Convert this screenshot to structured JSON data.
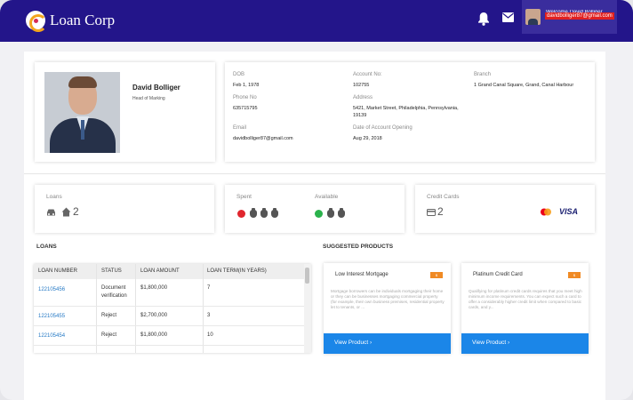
{
  "header": {
    "brand": "Loan Corp",
    "welcome": "Welcome David Bolliger",
    "user_email": "davidbolliger87@gmail.com"
  },
  "profile": {
    "name": "David Bolliger",
    "role": "Head of Marking"
  },
  "details": {
    "dob_label": "DOB",
    "dob": "Feb 1, 1978",
    "account_label": "Account No:",
    "account": "102755",
    "branch_label": "Branch",
    "branch": "1 Grand Canal Square, Grand, Canal Harbour",
    "phone_label": "Phone No",
    "phone": "635715795",
    "address_label": "Address",
    "address_line1": "5421, Market Street, Philadelphia, Pennsylvania,",
    "address_line2": "19139",
    "email_label": "Email",
    "email": "davidbolliger87@gmail.com",
    "opening_label": "Date of Account Opening",
    "opening": "Aug 29, 2018"
  },
  "stats": {
    "loans_label": "Loans",
    "loans_count": "2",
    "spent_label": "Spent",
    "available_label": "Available",
    "cards_label": "Credit Cards",
    "cards_count": "2",
    "card_brand_visa": "VISA"
  },
  "loans": {
    "title": "LOANS",
    "columns": [
      "LOAN NUMBER",
      "STATUS",
      "LOAN AMOUNT",
      "LOAN TERM(IN YEARS)"
    ],
    "rows": [
      {
        "number": "122105456",
        "status_line1": "Document",
        "status_line2": "verification",
        "amount": "$1,800,000",
        "term": "7"
      },
      {
        "number": "122105455",
        "status_line1": "Reject",
        "status_line2": "",
        "amount": "$2,700,000",
        "term": "3"
      },
      {
        "number": "122105454",
        "status_line1": "Reject",
        "status_line2": "",
        "amount": "$1,800,000",
        "term": "10"
      }
    ]
  },
  "products": {
    "title": "SUGGESTED PRODUCTS",
    "items": [
      {
        "name": "Low Interest Mortgage",
        "desc": "Mortgage borrowers can be individuals mortgaging their home or they can be businesses mortgaging commercial property (for example, their own business premises, residential property let to tenants, or ...",
        "button": "View Product  ›"
      },
      {
        "name": "Platinum Credit Card",
        "desc": "Qualifying for platinum credit cards requires that you meet high minimum income requirements. You can expect such a card to offer a considerably higher credit limit when compared to basic cards, and y...",
        "button": "View Product  ›"
      }
    ]
  },
  "colors": {
    "header_bg": "#23158a",
    "button_blue": "#1b86e8",
    "link_blue": "#2579c5",
    "spent_red": "#e0262e",
    "available_green": "#2bb24c",
    "badge_orange": "#f08a24"
  }
}
